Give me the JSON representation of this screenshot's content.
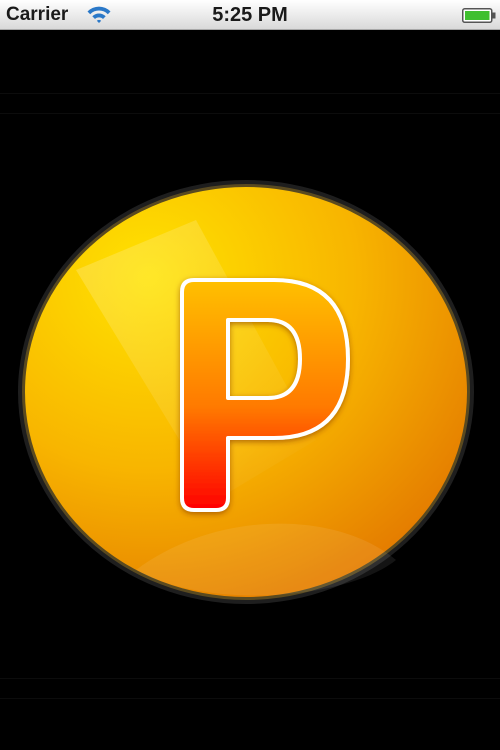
{
  "status_bar": {
    "carrier": "Carrier",
    "time": "5:25 PM",
    "wifi_icon": "wifi-icon",
    "battery_icon": "battery-full-icon"
  },
  "logo": {
    "letter": "P",
    "icon": "p-letter-circle-logo",
    "colors": {
      "circle_light": "#ffd400",
      "circle_dark": "#e88a00",
      "letter_top": "#ffb800",
      "letter_bottom": "#ff0000",
      "outline": "#ffffff",
      "rim": "#2a2a2a"
    }
  }
}
